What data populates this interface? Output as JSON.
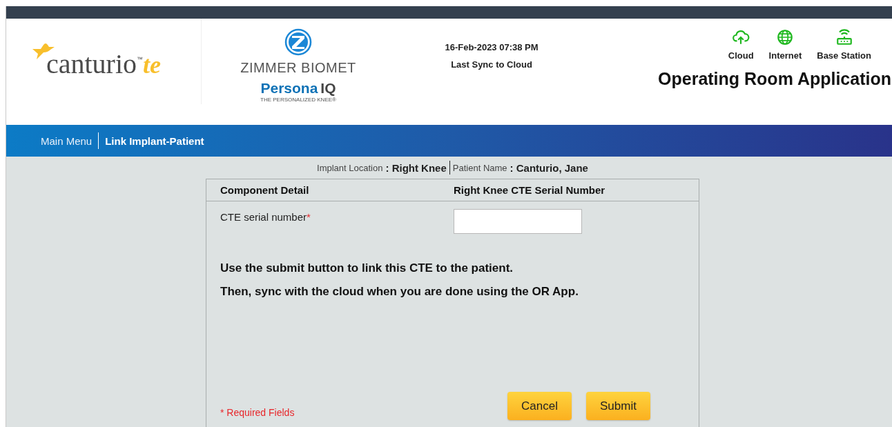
{
  "header": {
    "logo": {
      "name": "canturio",
      "trademark": "™",
      "suffix": "te"
    },
    "partner_logo": {
      "company": "ZIMMER BIOMET",
      "product": "Persona",
      "product_suffix": "IQ",
      "tagline": "THE PERSONALIZED KNEE®"
    },
    "sync": {
      "time": "16-Feb-2023 07:38 PM",
      "label": "Last Sync to Cloud"
    },
    "status": [
      {
        "kind": "cloud",
        "label": "Cloud",
        "connected": true
      },
      {
        "kind": "internet",
        "label": "Internet",
        "connected": true
      },
      {
        "kind": "base-station",
        "label": "Base Station",
        "connected": true
      }
    ],
    "app_title": "Operating Room Application"
  },
  "breadcrumb": [
    {
      "label": "Main Menu",
      "selected": false
    },
    {
      "label": "Link Implant-Patient",
      "selected": true
    }
  ],
  "context": [
    {
      "label": "Implant Location",
      "value": ": Right Knee"
    },
    {
      "label": "Patient Name",
      "value": ": Canturio, Jane"
    }
  ],
  "form": {
    "columns": [
      "Component Detail",
      "Right Knee CTE Serial Number"
    ],
    "field": {
      "label": "CTE serial number",
      "required_mark": "*"
    },
    "instructions": [
      "Use the submit button to link this CTE to the patient.",
      "Then, sync with the cloud when you are done using the OR App."
    ],
    "required_note": "* Required Fields",
    "buttons": [
      "Cancel",
      "Submit"
    ]
  }
}
